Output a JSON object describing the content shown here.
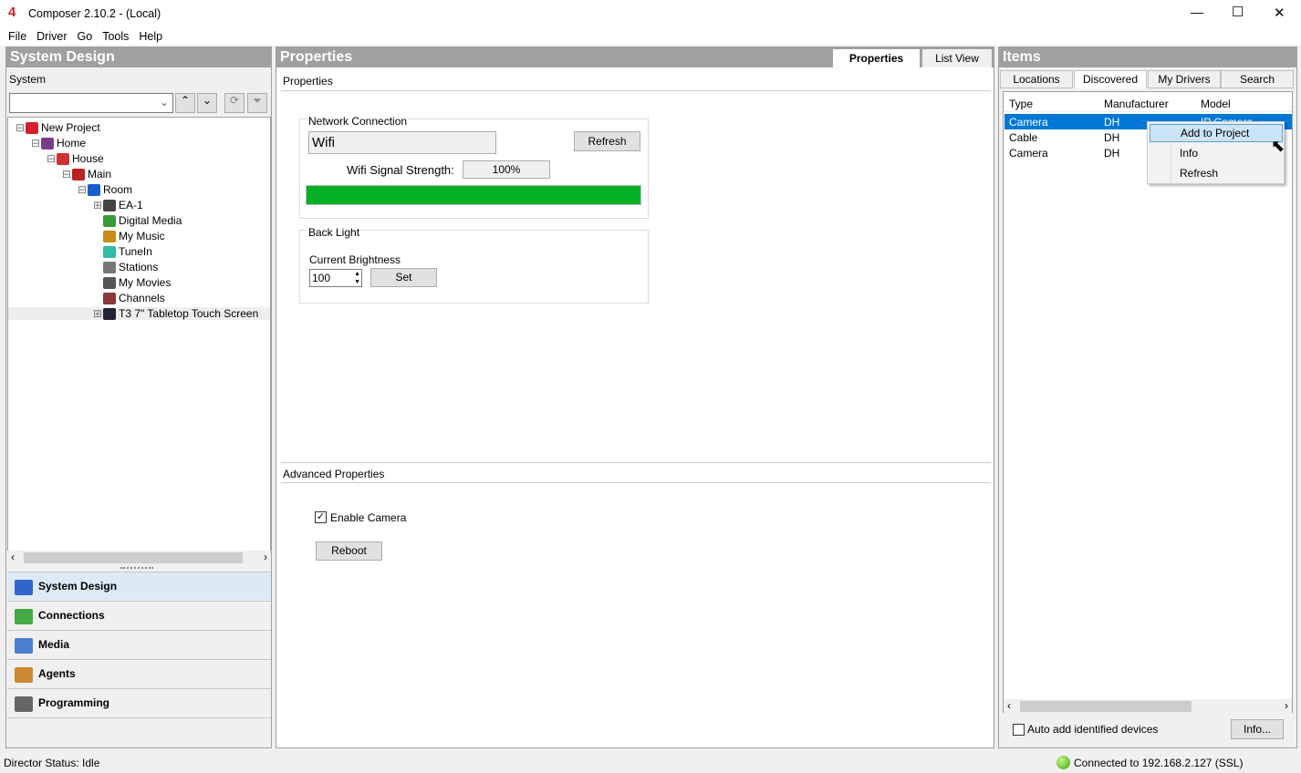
{
  "window": {
    "title": "Composer 2.10.2 - (Local)",
    "minimize": "—",
    "maximize": "☐",
    "close": "✕"
  },
  "menu": [
    "File",
    "Driver",
    "Go",
    "Tools",
    "Help"
  ],
  "system_design": {
    "title": "System Design",
    "label": "System",
    "tree": [
      {
        "label": "New Project",
        "color": "#d32027"
      },
      {
        "label": "Home",
        "color": "#7a3d8c"
      },
      {
        "label": "House",
        "color": "#c33"
      },
      {
        "label": "Main",
        "color": "#b22"
      },
      {
        "label": "Room",
        "color": "#1a5fd0"
      },
      {
        "label": "EA-1",
        "color": "#444"
      },
      {
        "label": "Digital Media",
        "color": "#3a9a3a"
      },
      {
        "label": "My Music",
        "color": "#c98a1a"
      },
      {
        "label": "TuneIn",
        "color": "#33bbaa"
      },
      {
        "label": "Stations",
        "color": "#777"
      },
      {
        "label": "My Movies",
        "color": "#555"
      },
      {
        "label": "Channels",
        "color": "#8a3a3a"
      },
      {
        "label": "T3 7\" Tabletop Touch Screen",
        "color": "#223"
      }
    ]
  },
  "nav": [
    {
      "label": "System Design",
      "color": "#3366cc"
    },
    {
      "label": "Connections",
      "color": "#44aa44"
    },
    {
      "label": "Media",
      "color": "#4a7fd0"
    },
    {
      "label": "Agents",
      "color": "#cc8833"
    },
    {
      "label": "Programming",
      "color": "#666"
    }
  ],
  "properties": {
    "title": "Properties",
    "tabs": [
      "Properties",
      "List View"
    ],
    "section": "Properties",
    "network": {
      "legend": "Network Connection",
      "type": "Wifi",
      "refresh": "Refresh",
      "signal_label": "Wifi Signal Strength:",
      "signal_value": "100%",
      "signal_percent": 100,
      "bar_color": "#06b025"
    },
    "backlight": {
      "legend": "Back Light",
      "brightness_label": "Current Brightness",
      "brightness": "100",
      "set": "Set"
    },
    "advanced": {
      "title": "Advanced Properties",
      "enable_camera": "Enable Camera",
      "enable_checked": true,
      "reboot": "Reboot"
    }
  },
  "items": {
    "title": "Items",
    "tabs": [
      "Locations",
      "Discovered",
      "My Drivers",
      "Search"
    ],
    "columns": [
      "Type",
      "Manufacturer",
      "Model"
    ],
    "rows": [
      {
        "type": "Camera",
        "manufacturer": "DH",
        "model": "IP Camera"
      },
      {
        "type": "Cable",
        "manufacturer": "DH",
        "model": ""
      },
      {
        "type": "Camera",
        "manufacturer": "DH",
        "model": ""
      }
    ],
    "context_menu": [
      "Add to Project",
      "Info",
      "Refresh"
    ],
    "auto_add": "Auto add identified devices",
    "info": "Info..."
  },
  "status": {
    "left": "Director Status: Idle",
    "right": "Connected to 192.168.2.127 (SSL)"
  }
}
